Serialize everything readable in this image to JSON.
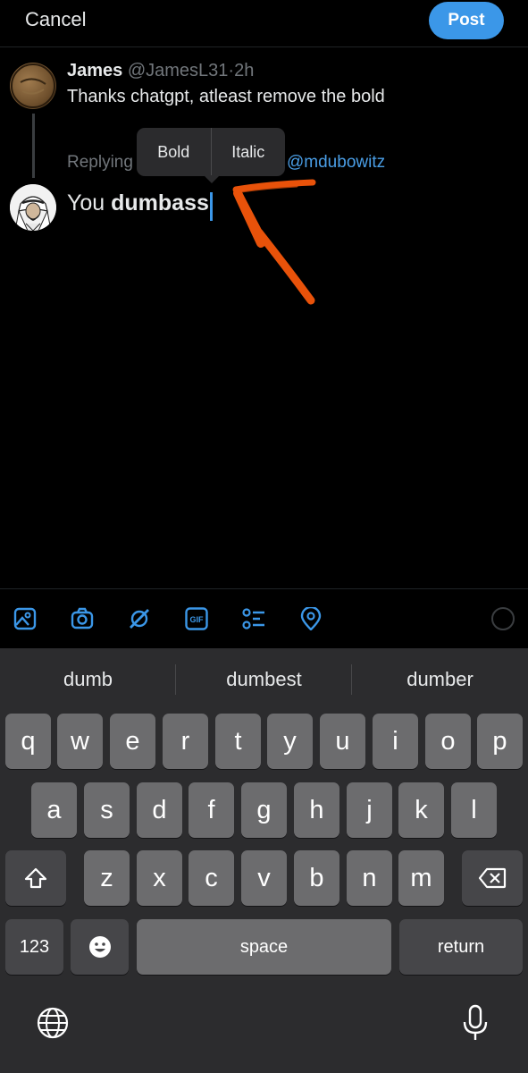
{
  "header": {
    "cancel_label": "Cancel",
    "post_label": "Post"
  },
  "tweet": {
    "name": "James",
    "handle": "@JamesL31",
    "separator": "·",
    "time": "2h",
    "text": "Thanks chatgpt, atleast remove the bold"
  },
  "reply": {
    "replying_label": "Replying",
    "to_handle": "@mdubowitz"
  },
  "format_menu": {
    "bold_label": "Bold",
    "italic_label": "Italic"
  },
  "compose": {
    "text_plain": "You ",
    "text_bold": "dumbass"
  },
  "annotation": {
    "arrow_color": "#e8520a"
  },
  "toolbar": {
    "icons": [
      "image-icon",
      "camera-icon",
      "grok-icon",
      "gif-icon",
      "poll-icon",
      "location-icon"
    ],
    "gif_label": "GIF",
    "accent_color": "#3b97e8"
  },
  "keyboard": {
    "suggestions": [
      "dumb",
      "dumbest",
      "dumber"
    ],
    "row1": [
      "q",
      "w",
      "e",
      "r",
      "t",
      "y",
      "u",
      "i",
      "o",
      "p"
    ],
    "row2": [
      "a",
      "s",
      "d",
      "f",
      "g",
      "h",
      "j",
      "k",
      "l"
    ],
    "row3": [
      "z",
      "x",
      "c",
      "v",
      "b",
      "n",
      "m"
    ],
    "numbers_label": "123",
    "space_label": "space",
    "return_label": "return"
  }
}
